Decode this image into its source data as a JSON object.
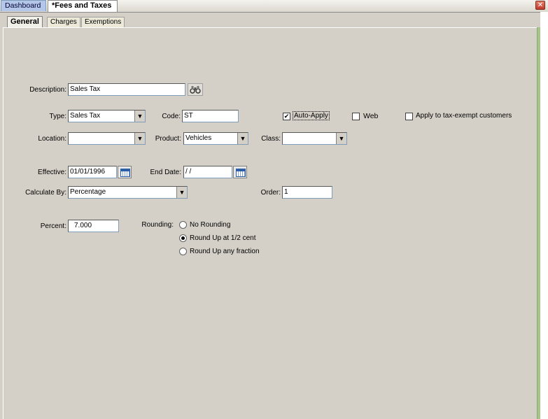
{
  "doc_tabs": {
    "dashboard": "Dashboard",
    "fees": "*Fees and Taxes",
    "close": "✕"
  },
  "inner_tabs": {
    "general": "General",
    "charges": "Charges",
    "exemptions": "Exemptions"
  },
  "form": {
    "description_label": "Description:",
    "description_value": "Sales Tax",
    "type_label": "Type:",
    "type_value": "Sales Tax",
    "code_label": "Code:",
    "code_value": "ST",
    "auto_apply_label": "Auto-Apply",
    "auto_apply_checked": "✔",
    "web_label": "Web",
    "apply_exempt_label": "Apply to tax-exempt customers",
    "location_label": "Location:",
    "location_value": "",
    "product_label": "Product:",
    "product_value": "Vehicles",
    "class_label": "Class:",
    "class_value": "",
    "effective_label": "Effective:",
    "effective_value": "01/01/1996",
    "end_date_label": "End Date:",
    "end_date_value": " /  /",
    "calculate_label": "Calculate By:",
    "calculate_value": "Percentage",
    "order_label": "Order:",
    "order_value": "1",
    "percent_label": "Percent:",
    "percent_value": "7.000",
    "rounding_label": "Rounding:",
    "rounding_options": [
      "No Rounding",
      "Round Up at 1/2 cent",
      "Round Up any fraction"
    ],
    "rounding_selected": "Round Up at 1/2 cent"
  },
  "icons": {
    "dropdown": "▼",
    "find": "binoculars-icon",
    "calendar": "calendar-icon"
  },
  "colors": {
    "background": "#d4d0c8",
    "active_tab": "#ffffff",
    "dashboard_tab": "#b4c7e8",
    "close": "#c0392b"
  }
}
